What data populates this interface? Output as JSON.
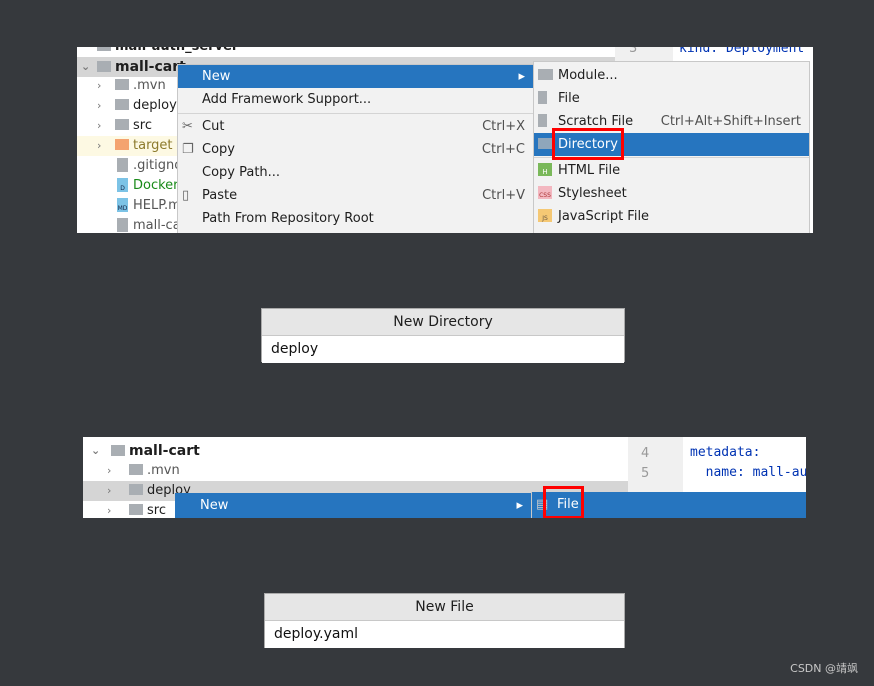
{
  "step1": {
    "tree": {
      "partial_top": "mall-auth_server",
      "project": "mall-cart",
      "items": [
        ".mvn",
        "deploy",
        "src",
        "target",
        ".gitignore",
        "Dockerfile",
        "HELP.md",
        "mall-cart"
      ]
    },
    "context_menu": {
      "items": [
        {
          "label": "New",
          "shortcut": "",
          "icon": "",
          "selected": true
        },
        {
          "label": "Add Framework Support...",
          "shortcut": "",
          "icon": ""
        },
        {
          "label": "Cut",
          "shortcut": "Ctrl+X",
          "icon": "scissors-icon"
        },
        {
          "label": "Copy",
          "shortcut": "Ctrl+C",
          "icon": "copy-icon"
        },
        {
          "label": "Copy Path...",
          "shortcut": "",
          "icon": ""
        },
        {
          "label": "Paste",
          "shortcut": "Ctrl+V",
          "icon": "clipboard-icon"
        },
        {
          "label": "Path From Repository Root",
          "shortcut": "",
          "icon": ""
        }
      ]
    },
    "submenu": {
      "items": [
        {
          "label": "Module...",
          "shortcut": "",
          "icon": "module-icon"
        },
        {
          "label": "File",
          "shortcut": "",
          "icon": "file-icon"
        },
        {
          "label": "Scratch File",
          "shortcut": "Ctrl+Alt+Shift+Insert",
          "icon": "scratch-file-icon"
        },
        {
          "label": "Directory",
          "shortcut": "",
          "icon": "folder-icon",
          "selected": true
        },
        {
          "label": "HTML File",
          "shortcut": "",
          "icon": "html-icon",
          "badge": "H"
        },
        {
          "label": "Stylesheet",
          "shortcut": "",
          "icon": "css-icon",
          "badge": "CSS"
        },
        {
          "label": "JavaScript File",
          "shortcut": "",
          "icon": "js-icon",
          "badge": "JS"
        }
      ]
    },
    "editor": {
      "line": "3",
      "code": "kind: Deployment"
    }
  },
  "step2": {
    "title": "New Directory",
    "value": "deploy"
  },
  "step3": {
    "tree": {
      "project": "mall-cart",
      "items": [
        ".mvn",
        "deploy",
        "src"
      ]
    },
    "menu_new": "New",
    "submenu_file": "File",
    "editor": {
      "lines": [
        {
          "num": "4",
          "code": "metadata:"
        },
        {
          "num": "5",
          "code": "  name: mall-au"
        }
      ]
    }
  },
  "step4": {
    "title": "New File",
    "value": "deploy.yaml"
  },
  "watermark": "CSDN @靖飒",
  "colors": {
    "selection": "#2675bf",
    "highlight": "#ff0000",
    "background": "#36393d"
  }
}
